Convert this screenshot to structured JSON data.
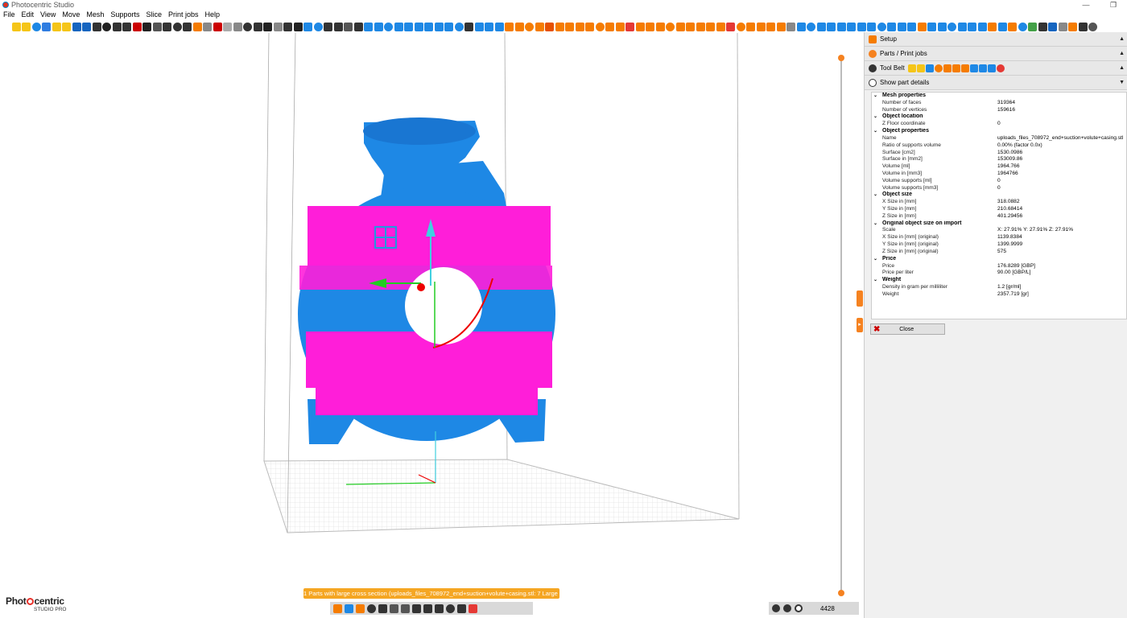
{
  "window": {
    "title": "Photocentric Studio",
    "controls": [
      "—",
      "❐"
    ]
  },
  "menu": [
    "File",
    "Edit",
    "View",
    "Move",
    "Mesh",
    "Supports",
    "Slice",
    "Print jobs",
    "Help"
  ],
  "toolbar_icon_colors": [
    "#fff",
    "#f5c518",
    "#f5c518",
    "#1e88e5",
    "#2f7de1",
    "#f5c518",
    "#f5c518",
    "#1565c0",
    "#1565c0",
    "#333",
    "#222",
    "#333",
    "#333",
    "#c00",
    "#222",
    "#555",
    "#333",
    "#333",
    "#333",
    "#f57c00",
    "#888",
    "#c00",
    "#aaa",
    "#888",
    "#333",
    "#333",
    "#222",
    "#888",
    "#333",
    "#222",
    "#1e88e5",
    "#1e88e5",
    "#333",
    "#333",
    "#555",
    "#333",
    "#1e88e5",
    "#1e88e5",
    "#1e88e5",
    "#1e88e5",
    "#1e88e5",
    "#1e88e5",
    "#1e88e5",
    "#1e88e5",
    "#1e88e5",
    "#1e88e5",
    "#333",
    "#1e88e5",
    "#1e88e5",
    "#1e88e5",
    "#f57c00",
    "#f57c00",
    "#f57c00",
    "#f57c00",
    "#e65100",
    "#f57c00",
    "#f57c00",
    "#f57c00",
    "#f57c00",
    "#f57c00",
    "#f57c00",
    "#f57c00",
    "#e53935",
    "#f57c00",
    "#f57c00",
    "#f57c00",
    "#f57c00",
    "#f57c00",
    "#f57c00",
    "#f57c00",
    "#f57c00",
    "#f57c00",
    "#e53935",
    "#f57c00",
    "#f57c00",
    "#f57c00",
    "#f57c00",
    "#f57c00",
    "#888",
    "#1e88e5",
    "#1e88e5",
    "#1e88e5",
    "#1e88e5",
    "#1e88e5",
    "#1e88e5",
    "#1e88e5",
    "#1e88e5",
    "#1e88e5",
    "#1e88e5",
    "#1e88e5",
    "#1e88e5",
    "#f57c00",
    "#1e88e5",
    "#1e88e5",
    "#1e88e5",
    "#1e88e5",
    "#1e88e5",
    "#1e88e5",
    "#f57c00",
    "#1e88e5",
    "#f57c00",
    "#1e88e5",
    "#43a047",
    "#333",
    "#1565c0",
    "#888",
    "#f57c00",
    "#333",
    "#555"
  ],
  "panel": {
    "setup": "Setup",
    "parts": "Parts / Print jobs",
    "tool_belt": "Tool Belt",
    "tool_belt_colors": [
      "#f5c518",
      "#f5c518",
      "#1e88e5",
      "#f57c00",
      "#f57c00",
      "#f57c00",
      "#f57c00",
      "#1e88e5",
      "#1e88e5",
      "#1e88e5",
      "#e53935"
    ],
    "show_details": "Show part details",
    "properties": [
      {
        "group": "Mesh properties",
        "rows": [
          [
            "Number of faces",
            "319364"
          ],
          [
            "Number of vertices",
            "159616"
          ]
        ]
      },
      {
        "group": "Object location",
        "rows": [
          [
            "Z Floor coordinate",
            "0"
          ]
        ]
      },
      {
        "group": "Object properties",
        "rows": [
          [
            "Name",
            "uploads_files_708972_end+suction+volute+casing.stl"
          ],
          [
            "Ratio of supports volume",
            "0.00% (factor 0.0x)"
          ],
          [
            "Surface [cm2]",
            "1530.0986"
          ],
          [
            "Surface in [mm2]",
            "153009.86"
          ],
          [
            "Volume [ml]",
            "1964.766"
          ],
          [
            "Volume in [mm3]",
            "1964766"
          ],
          [
            "Volume supports [ml]",
            "0"
          ],
          [
            "Volume supports [mm3]",
            "0"
          ]
        ]
      },
      {
        "group": "Object size",
        "rows": [
          [
            "X Size in [mm]",
            "318.0882"
          ],
          [
            "Y Size in [mm]",
            "210.68414"
          ],
          [
            "Z Size in [mm]",
            "401.29456"
          ]
        ]
      },
      {
        "group": "Original object size on import",
        "rows": [
          [
            "Scale",
            "X: 27.91% Y: 27.91% Z: 27.91%"
          ],
          [
            "X Size in [mm] (original)",
            "1139.8384"
          ],
          [
            "Y Size in [mm] (original)",
            "1399.9999"
          ],
          [
            "Z Size in [mm] (original)",
            "575"
          ]
        ]
      },
      {
        "group": "Price",
        "rows": [
          [
            "Price",
            "176.8289 [GBP]"
          ],
          [
            "Price per liter",
            "90.00 [GBP/L]"
          ]
        ]
      },
      {
        "group": "Weight",
        "rows": [
          [
            "Density in gram per milliliter",
            "1.2 [gr/ml]"
          ],
          [
            "Weight",
            "2357.719 [gr]"
          ]
        ]
      }
    ],
    "close": "Close"
  },
  "warning": "1 Parts with large cross section (uploads_files_708972_end+suction+volute+casing.stl: 7 Large ...)",
  "bottom_tool_colors": [
    "#f57c00",
    "#1e88e5",
    "#f57c00",
    "#333",
    "#333",
    "#555",
    "#555",
    "#333",
    "#333",
    "#333",
    "#333",
    "#333",
    "#e53935"
  ],
  "layer_count": "4428",
  "logo": {
    "brand_a": "Phot",
    "brand_b": "centric",
    "sub": "STUDIO PRO"
  },
  "colors": {
    "accent": "#f58220",
    "model": "#1e88e5",
    "highlight": "#ff1ed9",
    "warning": "#f5a623"
  }
}
